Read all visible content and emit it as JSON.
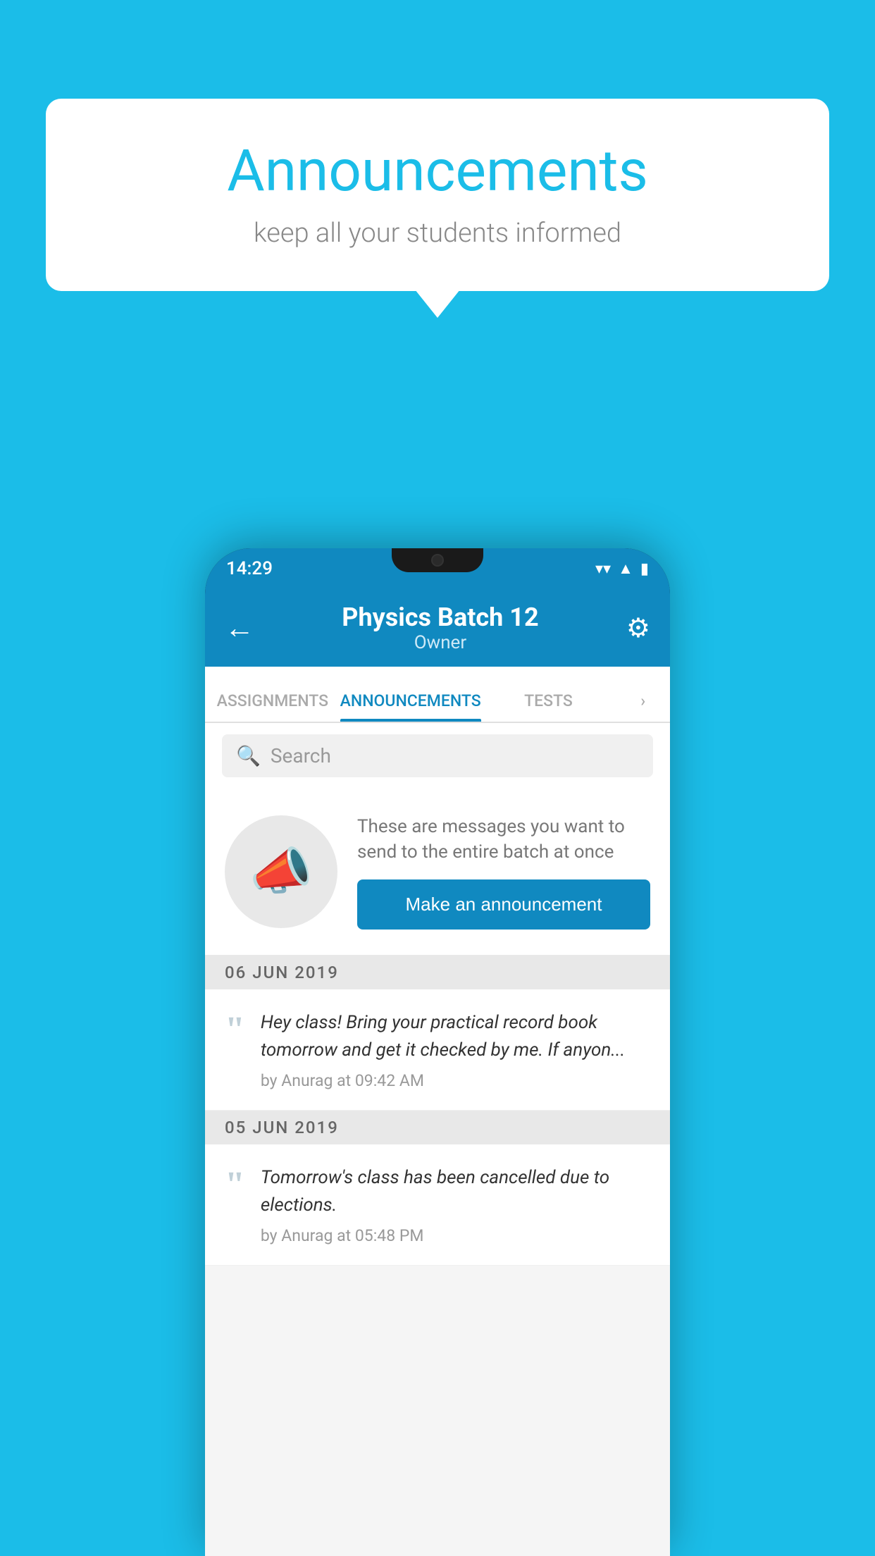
{
  "background_color": "#1BBDE8",
  "speech_bubble": {
    "title": "Announcements",
    "subtitle": "keep all your students informed"
  },
  "status_bar": {
    "time": "14:29",
    "icons": [
      "wifi",
      "signal",
      "battery"
    ]
  },
  "app_bar": {
    "title": "Physics Batch 12",
    "subtitle": "Owner",
    "back_label": "←",
    "gear_label": "⚙"
  },
  "tabs": [
    {
      "label": "ASSIGNMENTS",
      "active": false
    },
    {
      "label": "ANNOUNCEMENTS",
      "active": true
    },
    {
      "label": "TESTS",
      "active": false
    },
    {
      "label": "›",
      "active": false
    }
  ],
  "search": {
    "placeholder": "Search",
    "icon": "🔍"
  },
  "announcement_prompt": {
    "description": "These are messages you want to send to the entire batch at once",
    "button_label": "Make an announcement"
  },
  "announcements": [
    {
      "date": "06  JUN  2019",
      "message": "Hey class! Bring your practical record book tomorrow and get it checked by me. If anyon...",
      "meta": "by Anurag at 09:42 AM"
    },
    {
      "date": "05  JUN  2019",
      "message": "Tomorrow's class has been cancelled due to elections.",
      "meta": "by Anurag at 05:48 PM"
    }
  ]
}
